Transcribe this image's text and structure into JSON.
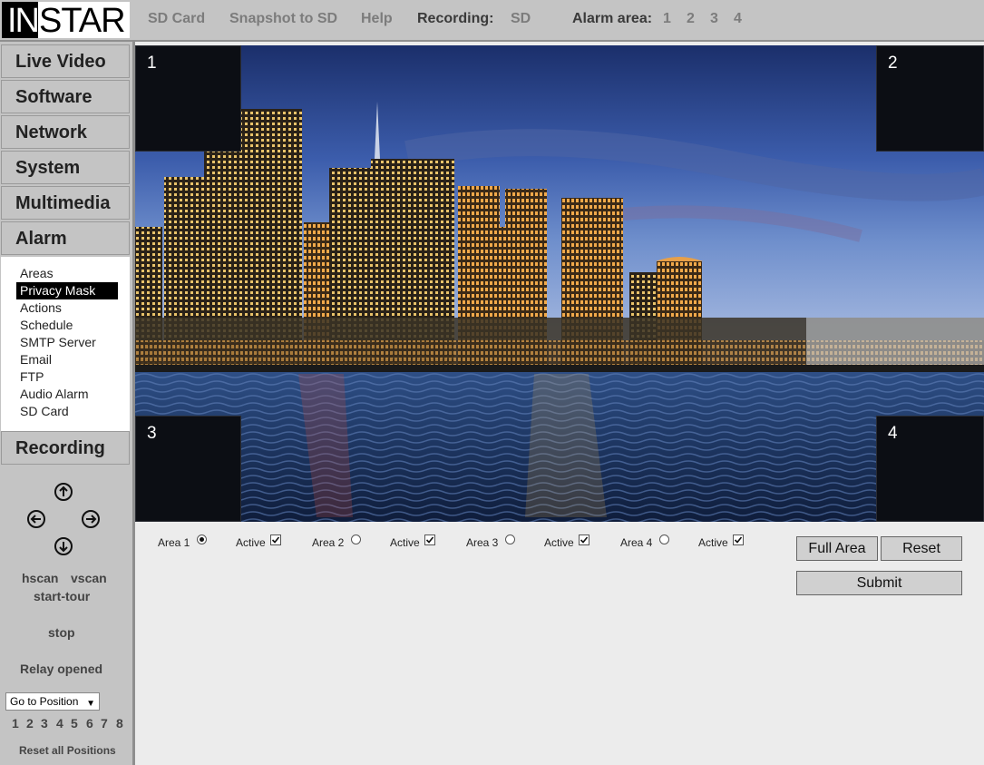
{
  "logo": {
    "left": "IN",
    "right": "STAR"
  },
  "topnav": {
    "sd_card": "SD Card",
    "snapshot": "Snapshot to SD",
    "help": "Help",
    "recording_label": "Recording:",
    "recording_sd": "SD",
    "alarm_area_label": "Alarm area:",
    "alarm_areas": [
      "1",
      "2",
      "3",
      "4"
    ]
  },
  "sidebar": {
    "menu": [
      "Live Video",
      "Software",
      "Network",
      "System",
      "Multimedia",
      "Alarm",
      "Recording"
    ],
    "submenu": [
      "Areas",
      "Privacy Mask",
      "Actions",
      "Schedule",
      "SMTP Server",
      "Email",
      "FTP",
      "Audio Alarm",
      "SD Card"
    ],
    "active_submenu": "Privacy Mask"
  },
  "ptz": {
    "hscan": "hscan",
    "vscan": "vscan",
    "start_tour": "start-tour",
    "stop": "stop",
    "relay": "Relay opened",
    "goto_select": "Go to Position",
    "positions": [
      "1",
      "2",
      "3",
      "4",
      "5",
      "6",
      "7",
      "8"
    ],
    "reset_positions": "Reset all Positions"
  },
  "video": {
    "area_labels": [
      "1",
      "2",
      "3",
      "4"
    ]
  },
  "areas": [
    {
      "label": "Area 1",
      "selected": true,
      "active_label": "Active",
      "active": true
    },
    {
      "label": "Area 2",
      "selected": false,
      "active_label": "Active",
      "active": true
    },
    {
      "label": "Area 3",
      "selected": false,
      "active_label": "Active",
      "active": true
    },
    {
      "label": "Area 4",
      "selected": false,
      "active_label": "Active",
      "active": true
    }
  ],
  "buttons": {
    "full_area": "Full Area",
    "reset": "Reset",
    "submit": "Submit"
  },
  "colors": {
    "active_menu_bg": "#000000",
    "panel_bg": "#c4c4c4",
    "content_bg": "#ececec"
  }
}
